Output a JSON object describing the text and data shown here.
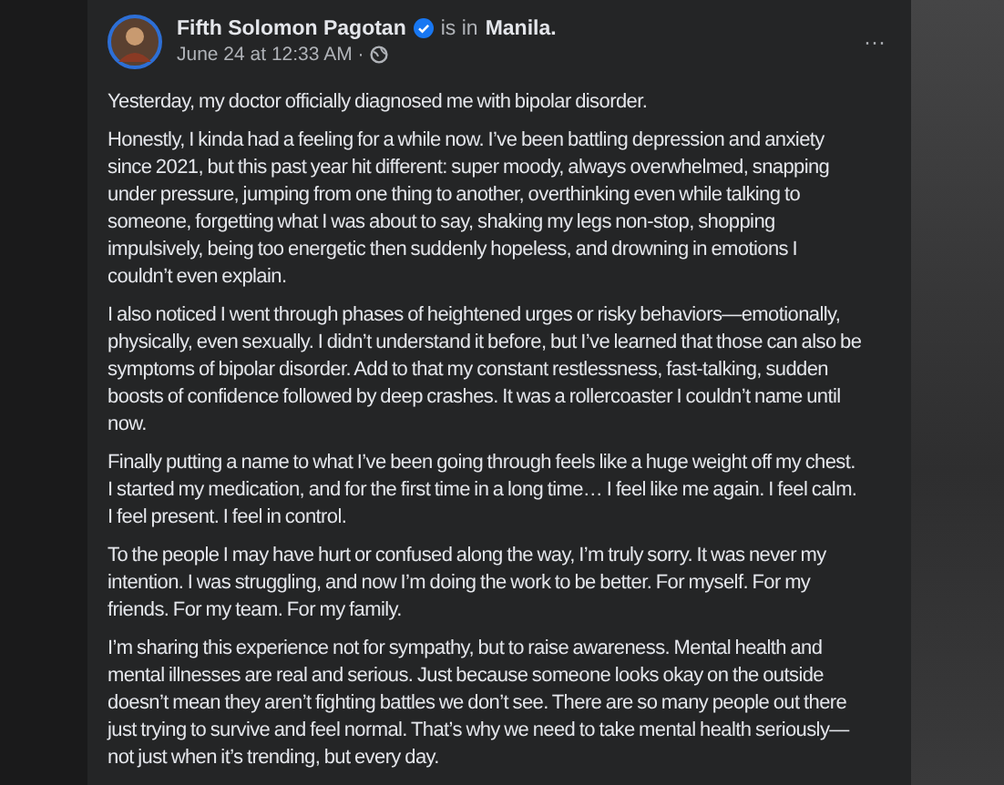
{
  "post": {
    "author": "Fifth Solomon Pagotan",
    "verified": true,
    "location_prefix": "is in",
    "location": "Manila.",
    "timestamp": "June 24 at 12:33 AM ·",
    "more": "···",
    "paragraphs": [
      "Yesterday, my doctor officially diagnosed me with bipolar disorder.",
      "Honestly, I kinda had a feeling for a while now. I’ve been battling depression and anxiety since 2021, but this past year hit different: super moody, always overwhelmed, snapping under pressure, jumping from one thing to another, overthinking even while talking to someone, forgetting what I was about to say, shaking my legs non-stop, shopping impulsively, being too energetic then suddenly hopeless, and drowning in emotions I couldn’t even explain.",
      "I also noticed I went through phases of heightened urges or risky behaviors—emotionally, physically, even sexually. I didn’t understand it before, but I’ve learned that those can also be symptoms of bipolar disorder. Add to that my constant restlessness, fast-talking, sudden boosts of confidence followed by deep crashes. It was a rollercoaster I couldn’t name until now.",
      "Finally putting a name to what I’ve been going through feels like a huge weight off my chest. I started my medication, and for the first time in a long time… I feel like me again. I feel calm. I feel present. I feel in control.",
      "To the people I may have hurt or confused along the way, I’m truly sorry. It was never my intention. I was struggling, and now I’m doing the work to be better. For myself. For my friends. For my team. For my family.",
      "I’m sharing this experience not for sympathy, but to raise awareness. Mental health and mental illnesses are real and serious. Just because someone looks okay on the outside doesn’t mean they aren’t fighting battles we don’t see. There are so many people out there just trying to survive and feel normal. That’s why we need to take mental health seriously—not just when it’s trending, but every day."
    ]
  }
}
